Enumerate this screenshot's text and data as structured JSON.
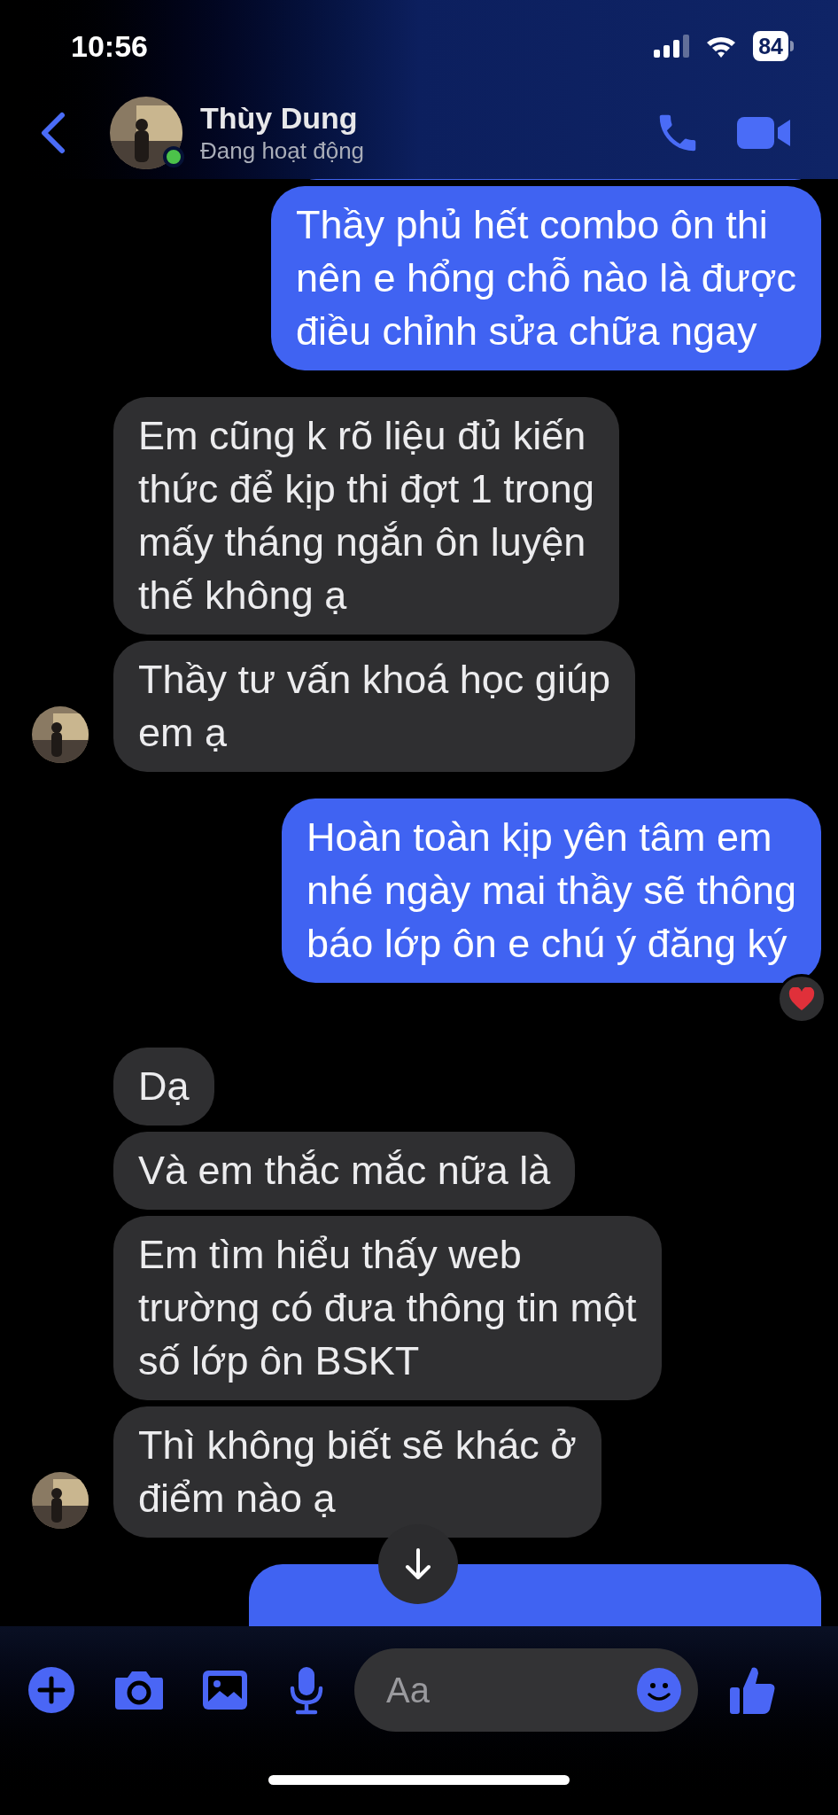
{
  "status_bar": {
    "time": "10:56",
    "battery": "84"
  },
  "header": {
    "name": "Thùy Dung",
    "status": "Đang hoạt động",
    "online": true
  },
  "messages": [
    {
      "kind": "sent"
    },
    {
      "kind": "sent",
      "text": "Thầy phủ hết combo ôn thi\nnên e hổng chỗ nào là được\nđiều chỉnh sửa chữa ngay"
    },
    {
      "kind": "received",
      "text": "Em cũng k rõ liệu đủ kiến\nthức để kịp thi đợt 1 trong\nmấy tháng ngắn ôn luyện\nthế không ạ"
    },
    {
      "kind": "received",
      "text": "Thầy tư vấn khoá học giúp\nem ạ"
    },
    {
      "kind": "sent",
      "text": "Hoàn toàn kịp yên tâm em\nnhé ngày mai thầy sẽ thông\nbáo lớp ôn e chú ý đăng ký",
      "hearted": true
    },
    {
      "kind": "received",
      "text": "Dạ"
    },
    {
      "kind": "received",
      "text": "Và em thắc mắc nữa là"
    },
    {
      "kind": "received",
      "text": "Em tìm hiểu thấy web\ntrường có đưa thông tin một\nsố lớp ôn BSKT"
    },
    {
      "kind": "received",
      "text": "Thì không biết sẽ khác ở\nđiểm nào ạ"
    },
    {
      "kind": "sent"
    }
  ],
  "composer": {
    "placeholder": "Aa"
  }
}
